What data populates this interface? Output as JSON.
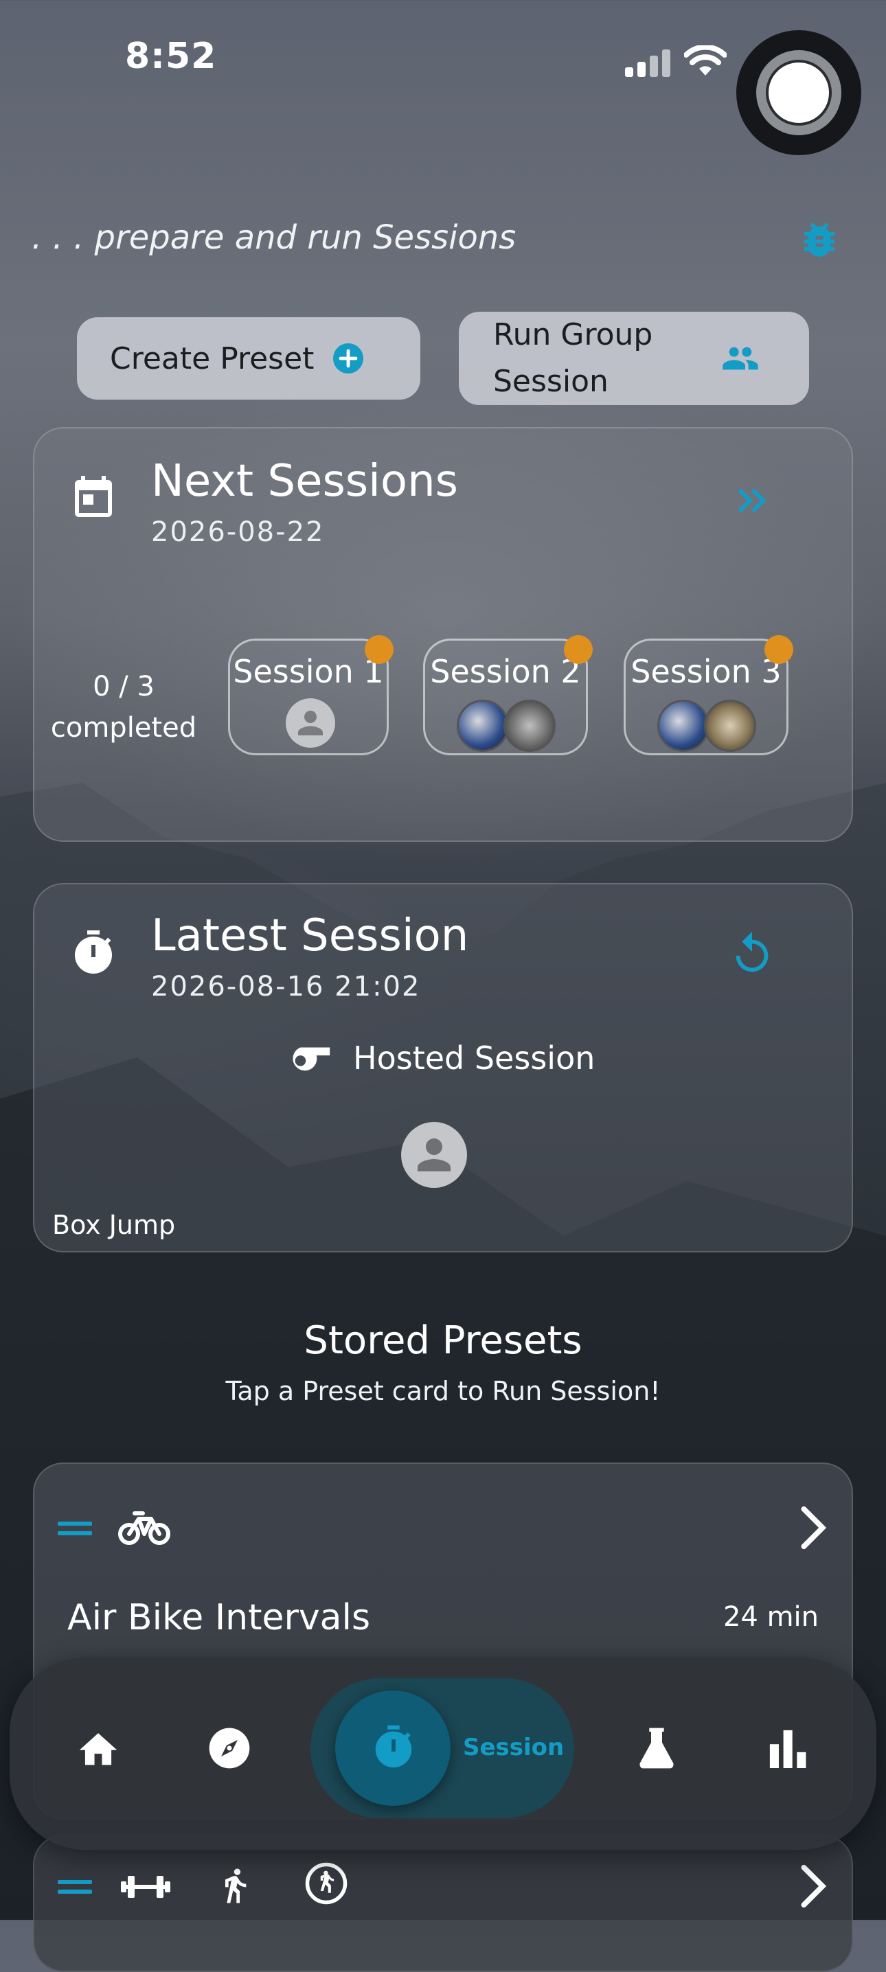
{
  "status_bar": {
    "time": "8:52"
  },
  "header": {
    "tagline": ". . . prepare and run Sessions"
  },
  "actions": {
    "create_preset": "Create Preset",
    "run_group_session_line1": "Run Group",
    "run_group_session_line2": "Session"
  },
  "next_sessions": {
    "title": "Next Sessions",
    "date": "2026-08-22",
    "progress_line1": "0 / 3",
    "progress_line2": "completed",
    "sessions": [
      {
        "label": "Session 1"
      },
      {
        "label": "Session 2"
      },
      {
        "label": "Session 3"
      }
    ]
  },
  "latest_session": {
    "title": "Latest Session",
    "datetime": "2026-08-16 21:02",
    "host_label": "Hosted Session",
    "exercise": "Box Jump"
  },
  "stored_presets": {
    "title": "Stored Presets",
    "subtitle": "Tap a Preset card to Run Session!",
    "items": [
      {
        "name": "Air Bike Intervals",
        "duration": "24 min"
      }
    ]
  },
  "tabbar": {
    "active_label": "Session"
  },
  "colors": {
    "accent": "#139dc6",
    "badge": "#e0901d",
    "button_bg": "#c4c7ce"
  }
}
